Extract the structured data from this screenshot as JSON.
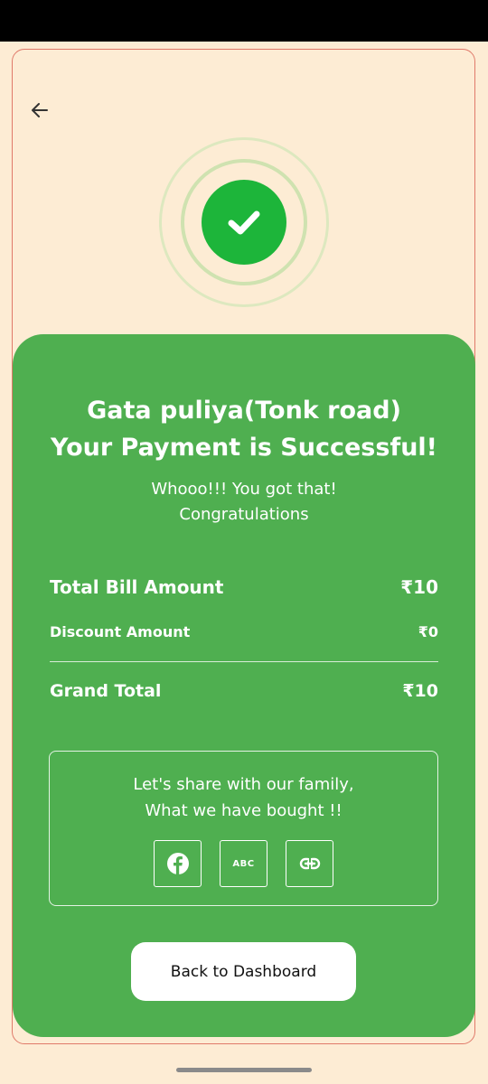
{
  "header": {
    "back_icon": "arrow-left-icon"
  },
  "success": {
    "icon": "check-icon",
    "accent": "#1db53a"
  },
  "card": {
    "background": "#4faf50",
    "store_name": "Gata puliya(Tonk road)",
    "headline": "Your Payment is Successful!",
    "message_line1": "Whooo!!! You got that!",
    "message_line2": "Congratulations"
  },
  "bill": {
    "total_label": "Total Bill Amount",
    "total_value": "₹10",
    "discount_label": "Discount Amount",
    "discount_value": "₹0",
    "grand_label": "Grand Total",
    "grand_value": "₹10"
  },
  "share": {
    "line1": "Let's share with our family,",
    "line2": "What we have bought !!",
    "buttons": [
      {
        "icon": "facebook-icon"
      },
      {
        "icon": "abc-icon",
        "label": "ABC"
      },
      {
        "icon": "link-icon"
      }
    ]
  },
  "actions": {
    "dashboard_label": "Back to Dashboard"
  }
}
